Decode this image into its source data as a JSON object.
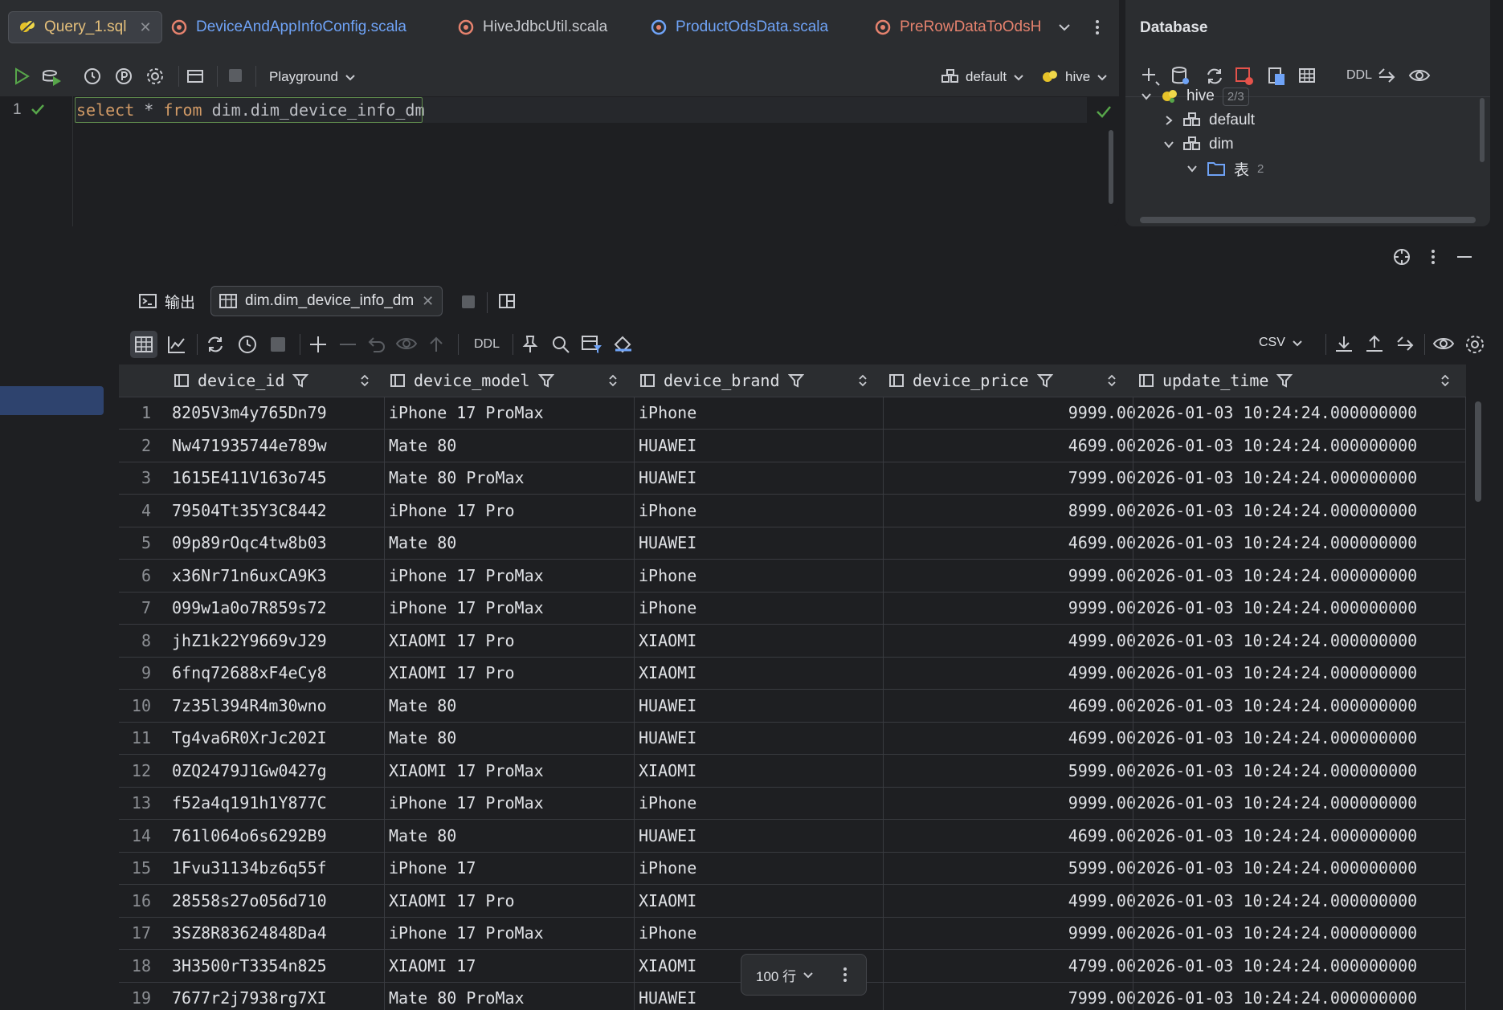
{
  "editor": {
    "tabs": [
      {
        "label": "Query_1.sql",
        "active": true
      },
      {
        "label": "DeviceAndAppInfoConfig.scala"
      },
      {
        "label": "HiveJdbcUtil.scala"
      },
      {
        "label": "ProductOdsData.scala"
      },
      {
        "label": "PreRowDataToOdsH"
      }
    ],
    "toolbar": {
      "playground_label": "Playground",
      "schema": "default",
      "datasource": "hive"
    },
    "line_number": "1",
    "sql": {
      "kw_select": "select",
      "star": " * ",
      "kw_from": "from",
      "rest": " dim.dim_device_info_dm"
    }
  },
  "database": {
    "title": "Database",
    "ddl_label": "DDL",
    "tree": {
      "hive_label": "hive",
      "hive_badge": "2/3",
      "default_label": "default",
      "dim_label": "dim",
      "tables_label": "表",
      "tables_count": "2"
    }
  },
  "results": {
    "tabs": {
      "output_label": "输出",
      "table_label": "dim.dim_device_info_dm"
    },
    "ddl_label": "DDL",
    "export_format": "CSV",
    "columns": [
      "device_id",
      "device_model",
      "device_brand",
      "device_price",
      "update_time"
    ],
    "rows": [
      [
        "1",
        "8205V3m4y765Dn79",
        "iPhone 17 ProMax",
        "iPhone",
        "9999.00",
        "2026-01-03 10:24:24.000000000"
      ],
      [
        "2",
        "Nw471935744e789w",
        "Mate 80",
        "HUAWEI",
        "4699.00",
        "2026-01-03 10:24:24.000000000"
      ],
      [
        "3",
        "1615E411V163o745",
        "Mate 80 ProMax",
        "HUAWEI",
        "7999.00",
        "2026-01-03 10:24:24.000000000"
      ],
      [
        "4",
        "79504Tt35Y3C8442",
        "iPhone 17 Pro",
        "iPhone",
        "8999.00",
        "2026-01-03 10:24:24.000000000"
      ],
      [
        "5",
        "09p89rOqc4tw8b03",
        "Mate 80",
        "HUAWEI",
        "4699.00",
        "2026-01-03 10:24:24.000000000"
      ],
      [
        "6",
        "x36Nr71n6uxCA9K3",
        "iPhone 17 ProMax",
        "iPhone",
        "9999.00",
        "2026-01-03 10:24:24.000000000"
      ],
      [
        "7",
        "099w1a0o7R859s72",
        "iPhone 17 ProMax",
        "iPhone",
        "9999.00",
        "2026-01-03 10:24:24.000000000"
      ],
      [
        "8",
        "jhZ1k22Y9669vJ29",
        "XIAOMI 17 Pro",
        "XIAOMI",
        "4999.00",
        "2026-01-03 10:24:24.000000000"
      ],
      [
        "9",
        "6fnq72688xF4eCy8",
        "XIAOMI 17 Pro",
        "XIAOMI",
        "4999.00",
        "2026-01-03 10:24:24.000000000"
      ],
      [
        "10",
        "7z35l394R4m30wno",
        "Mate 80",
        "HUAWEI",
        "4699.00",
        "2026-01-03 10:24:24.000000000"
      ],
      [
        "11",
        "Tg4va6R0XrJc202I",
        "Mate 80",
        "HUAWEI",
        "4699.00",
        "2026-01-03 10:24:24.000000000"
      ],
      [
        "12",
        "0ZQ2479J1Gw0427g",
        "XIAOMI 17 ProMax",
        "XIAOMI",
        "5999.00",
        "2026-01-03 10:24:24.000000000"
      ],
      [
        "13",
        "f52a4q191h1Y877C",
        "iPhone 17 ProMax",
        "iPhone",
        "9999.00",
        "2026-01-03 10:24:24.000000000"
      ],
      [
        "14",
        "761l064o6s6292B9",
        "Mate 80",
        "HUAWEI",
        "4699.00",
        "2026-01-03 10:24:24.000000000"
      ],
      [
        "15",
        "1Fvu31134bz6q55f",
        "iPhone 17",
        "iPhone",
        "5999.00",
        "2026-01-03 10:24:24.000000000"
      ],
      [
        "16",
        "28558s27o056d710",
        "XIAOMI 17 Pro",
        "XIAOMI",
        "4999.00",
        "2026-01-03 10:24:24.000000000"
      ],
      [
        "17",
        "3SZ8R83624848Da4",
        "iPhone 17 ProMax",
        "iPhone",
        "9999.00",
        "2026-01-03 10:24:24.000000000"
      ],
      [
        "18",
        "3H3500rT3354n825",
        "XIAOMI 17",
        "XIAOMI",
        "4799.00",
        "2026-01-03 10:24:24.000000000"
      ],
      [
        "19",
        "7677r2j7938rg7XI",
        "Mate 80 ProMax",
        "HUAWEI",
        "7999.00",
        "2026-01-03 10:24:24.000000000"
      ]
    ],
    "page_size_label": "100 行"
  }
}
